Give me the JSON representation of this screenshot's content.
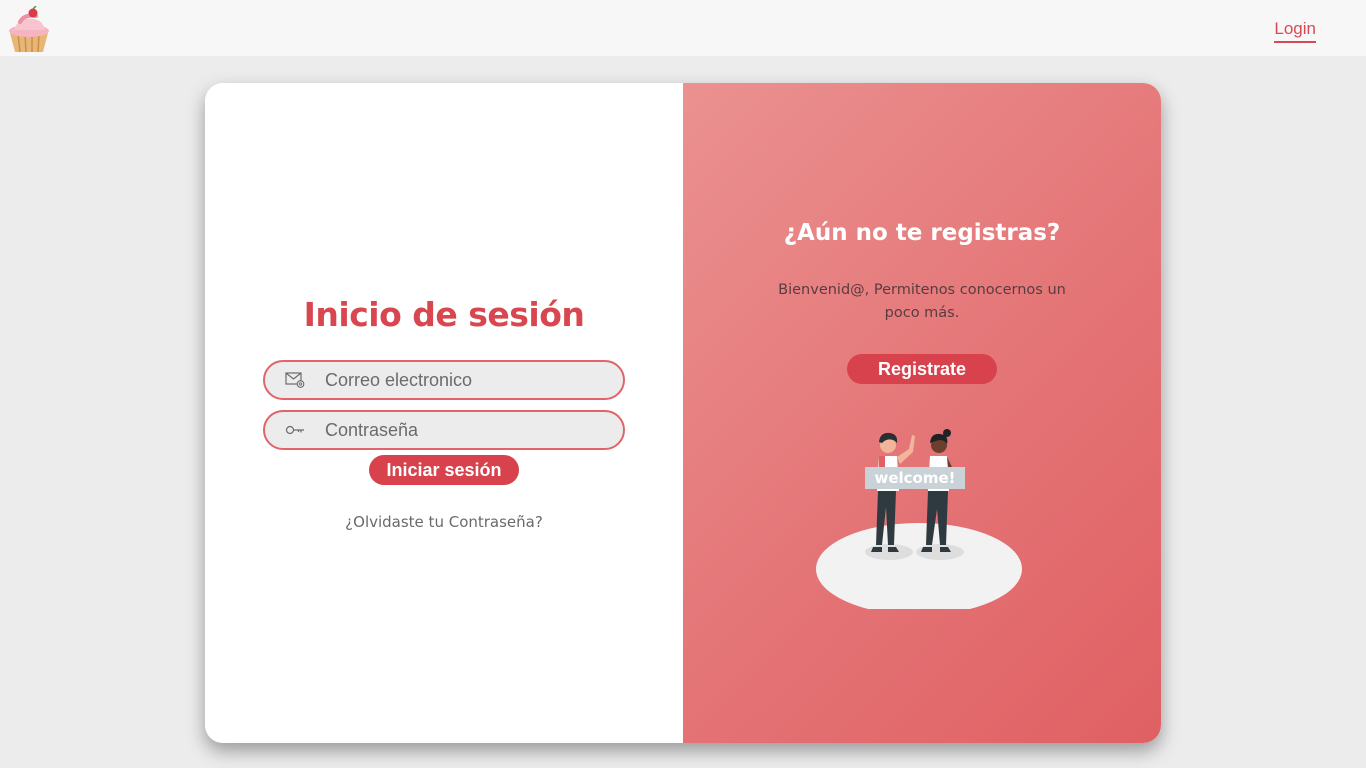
{
  "header": {
    "logo_icon": "cupcake-logo-icon",
    "login_link": "Login"
  },
  "login": {
    "title": "Inicio de sesión",
    "email_placeholder": "Correo electronico",
    "email_icon": "envelope-at-icon",
    "password_placeholder": "Contraseña",
    "password_icon": "key-icon",
    "submit_label": "Iniciar sesión",
    "forgot_link": "¿Olvidaste tu Contraseña?"
  },
  "register": {
    "title": "¿Aún no te registras?",
    "text": "Bienvenid@, Permitenos conocernos un poco más.",
    "button_label": "Registrate",
    "illustration": {
      "icon": "welcome-people-illustration",
      "sign_text": "welcome!"
    }
  },
  "colors": {
    "accent": "#d8424c",
    "panel_gradient_start": "#eb9190",
    "panel_gradient_end": "#e06063",
    "page_bg": "#ececec"
  }
}
